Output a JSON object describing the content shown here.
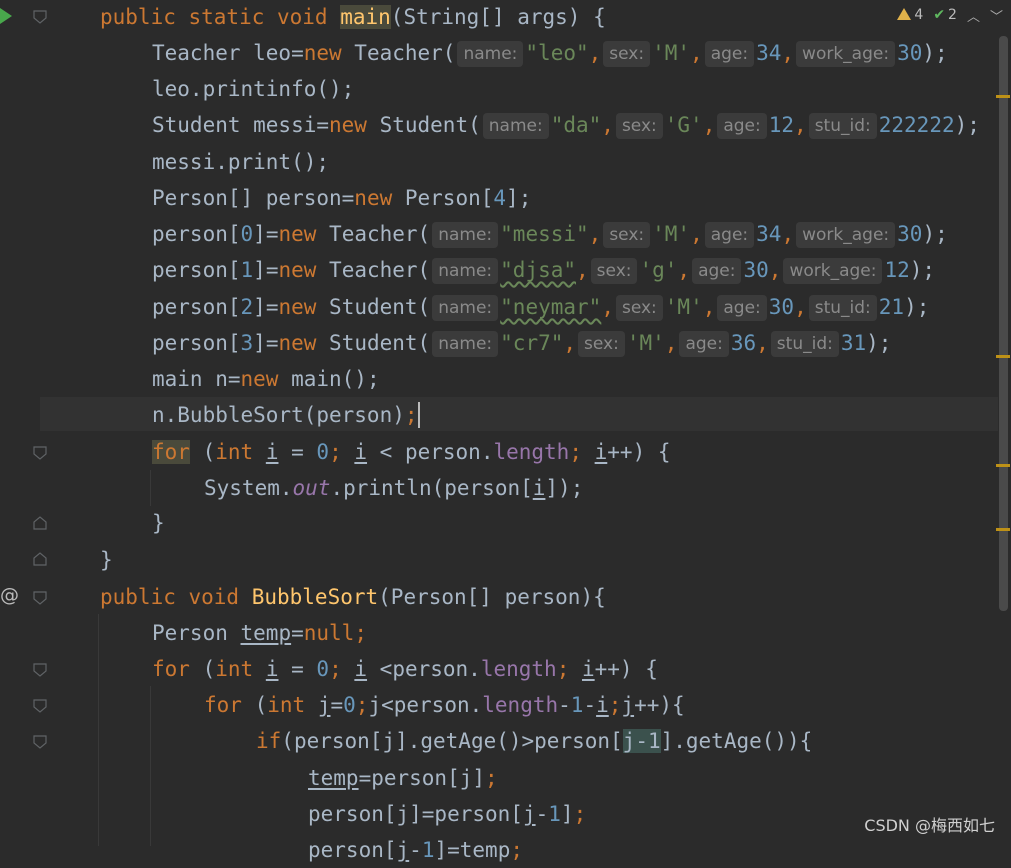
{
  "inspection": {
    "warnings": "4",
    "ok": "2",
    "prev_icon": "chevron-up-icon",
    "next_icon": "chevron-down-icon"
  },
  "code": {
    "l1": {
      "kw1": "public static void ",
      "name": "main",
      "rest": "(String[] args) {"
    },
    "l2": {
      "pre": "Teacher leo=",
      "kw": "new",
      "cls": " Teacher(",
      "h1": "name:",
      "v1": "\"leo\"",
      "h2": "sex:",
      "v2": "'M'",
      "h3": "age:",
      "v3": "34",
      "h4": "work_age:",
      "v4": "30",
      "end": ");"
    },
    "l3": {
      "text": "leo.printinfo();"
    },
    "l4": {
      "pre": "Student messi=",
      "kw": "new",
      "cls": " Student(",
      "h1": "name:",
      "v1": "\"da\"",
      "h2": "sex:",
      "v2": "'G'",
      "h3": "age:",
      "v3": "12",
      "h4": "stu_id:",
      "v4": "222222",
      "end": ");"
    },
    "l5": {
      "text": "messi.print();"
    },
    "l6": {
      "pre": "Person[] person=",
      "kw": "new",
      "mid": " Person[",
      "num": "4",
      "end": "];"
    },
    "l7": {
      "pre": "person[",
      "idx": "0",
      "mid": "]=",
      "kw": "new",
      "cls": " Teacher(",
      "h1": "name:",
      "v1": "\"messi\"",
      "h2": "sex:",
      "v2": "'M'",
      "h3": "age:",
      "v3": "34",
      "h4": "work_age:",
      "v4": "30",
      "end": ");"
    },
    "l8": {
      "pre": "person[",
      "idx": "1",
      "mid": "]=",
      "kw": "new",
      "cls": " Teacher(",
      "h1": "name:",
      "v1": "\"djsa\"",
      "h2": "sex:",
      "v2": "'g'",
      "h3": "age:",
      "v3": "30",
      "h4": "work_age:",
      "v4": "12",
      "end": ");"
    },
    "l9": {
      "pre": "person[",
      "idx": "2",
      "mid": "]=",
      "kw": "new",
      "cls": " Student(",
      "h1": "name:",
      "v1": "\"neymar\"",
      "h2": "sex:",
      "v2": "'M'",
      "h3": "age:",
      "v3": "30",
      "h4": "stu_id:",
      "v4": "21",
      "end": ");"
    },
    "l10": {
      "pre": "person[",
      "idx": "3",
      "mid": "]=",
      "kw": "new",
      "cls": " Student(",
      "h1": "name:",
      "v1": "\"cr7\"",
      "h2": "sex:",
      "v2": "'M'",
      "h3": "age:",
      "v3": "36",
      "h4": "stu_id:",
      "v4": "31",
      "end": ");"
    },
    "l11": {
      "pre": "main n=",
      "kw": "new",
      "end": " main();"
    },
    "l12": {
      "pre": "n.BubbleSort(person)",
      "end": ";"
    },
    "l13": {
      "kw": "for",
      "p1": " (",
      "kw2": "int",
      "sp": " ",
      "var": "i",
      "p2": " = ",
      "num": "0",
      "semi1": "; ",
      "var2": "i",
      "p3": " < person.",
      "field": "length",
      "semi2": "; ",
      "var3": "i",
      "end": "++) {"
    },
    "l14": {
      "pre": "System.",
      "st": "out",
      "mid": ".println(person[",
      "var": "i",
      "end": "]);"
    },
    "l15": {
      "text": "}"
    },
    "l16": {
      "text": "}"
    },
    "l17": {
      "kw": "public void ",
      "name": "BubbleSort",
      "rest": "(Person[] person){"
    },
    "l18": {
      "pre": "Person ",
      "var": "temp",
      "eq": "=",
      "kw": "null",
      "end": ";"
    },
    "l19": {
      "kw": "for",
      "p1": " (",
      "kw2": "int",
      "sp": " ",
      "var": "i",
      "p2": " = ",
      "num": "0",
      "semi1": "; ",
      "var2": "i",
      "p3": " <person.",
      "field": "length",
      "semi2": "; ",
      "var3": "i",
      "end": "++) {"
    },
    "l20": {
      "kw": "for",
      "p1": " (",
      "kw2": "int",
      "sp": " ",
      "var": "j",
      "eq": "=",
      "num": "0",
      "semi1": ";",
      "var2": "j",
      "p3": "<person.",
      "field": "length",
      "op": "-",
      "num2": "1",
      "op2": "-",
      "var3": "i",
      "semi2": ";",
      "var4": "j",
      "end": "++){"
    },
    "l21": {
      "kw": "if",
      "pre": "(person[j].getAge()>person[",
      "hl": "j-1",
      "end": "].getAge()){"
    },
    "l22": {
      "var": "temp",
      "mid": "=person[j]",
      "end": ";"
    },
    "l23": {
      "pre": "person[j]=person[",
      "var": "j",
      "op": "-",
      "num": "1",
      "mid": "]",
      "end": ";"
    },
    "l24": {
      "pre": "person[",
      "var": "j",
      "op": "-",
      "num": "1",
      "mid": "]=temp",
      "end": ";"
    }
  },
  "watermark": "CSDN @梅西如七"
}
